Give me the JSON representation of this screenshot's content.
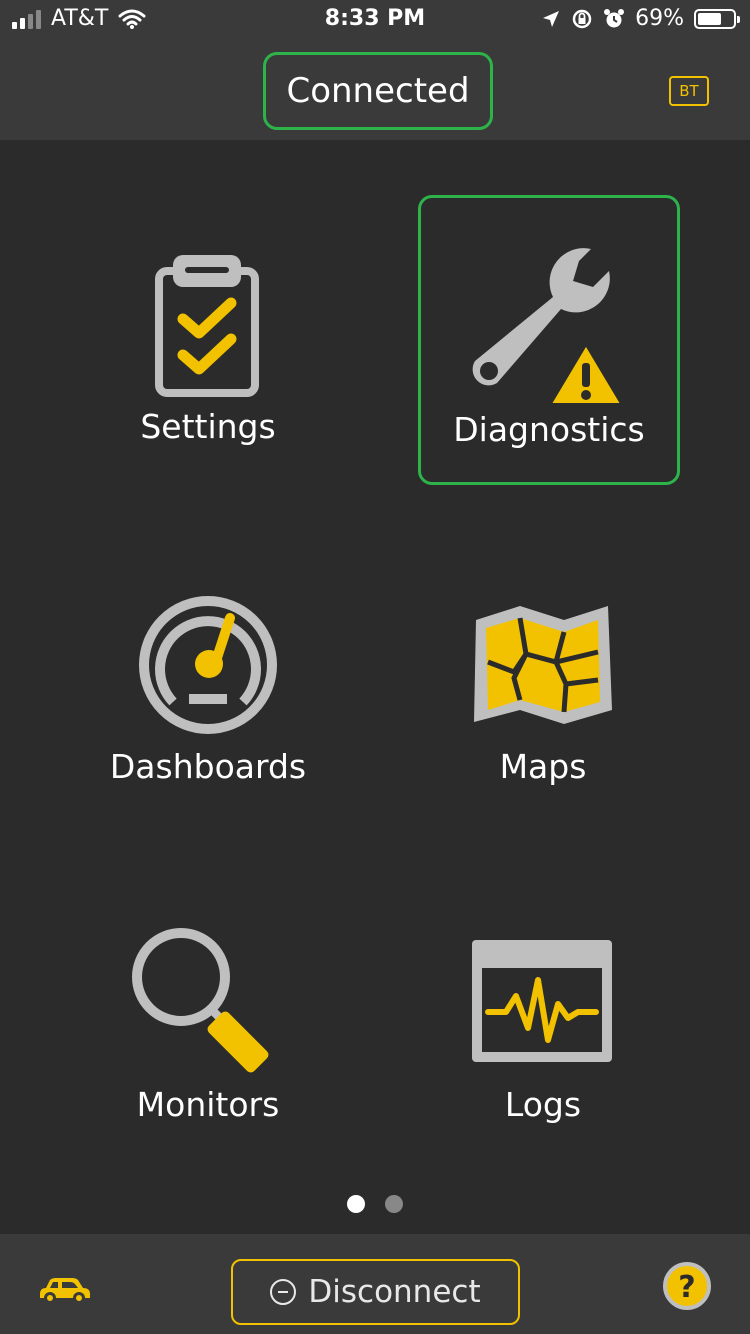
{
  "status_bar": {
    "carrier": "AT&T",
    "time": "8:33 PM",
    "battery": "69%",
    "battery_level": 0.69
  },
  "header": {
    "status": "Connected",
    "bt_badge": "BT"
  },
  "menu": {
    "items": [
      {
        "label": "Settings"
      },
      {
        "label": "Diagnostics"
      },
      {
        "label": "Dashboards"
      },
      {
        "label": "Maps"
      },
      {
        "label": "Monitors"
      },
      {
        "label": "Logs"
      }
    ]
  },
  "pager": {
    "pages": 2,
    "current": 1
  },
  "bottom_bar": {
    "disconnect_label": "Disconnect",
    "help_label": "?"
  },
  "colors": {
    "accent_yellow": "#f2c200",
    "highlight_green": "#2db34a",
    "icon_gray": "#bfbfbf",
    "background": "#2b2b2b",
    "bar_background": "#3a3a3a"
  }
}
